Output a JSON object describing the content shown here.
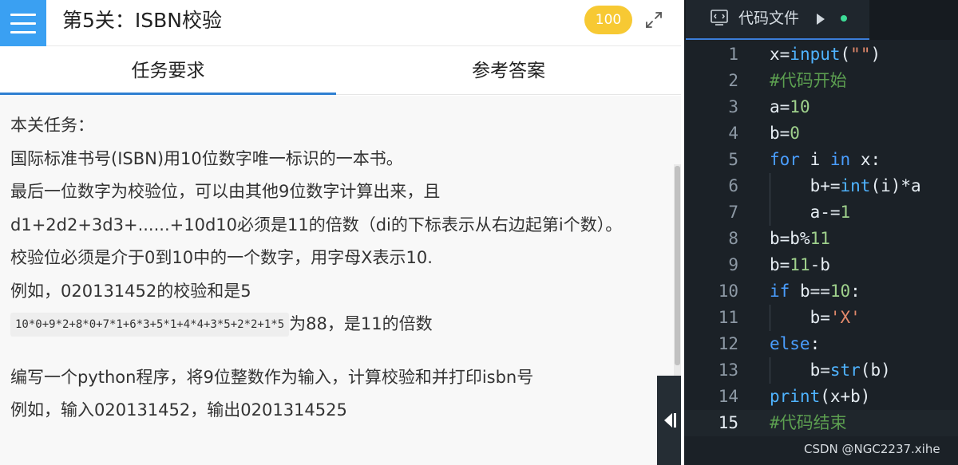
{
  "header": {
    "title": "第5关：ISBN校验",
    "score": "100"
  },
  "tabs": [
    {
      "label": "任务要求",
      "active": true
    },
    {
      "label": "参考答案",
      "active": false
    }
  ],
  "task": {
    "lines": [
      "本关任务：",
      "国际标准书号(ISBN)用10位数字唯一标识的一本书。",
      "最后一位数字为校验位，可以由其他9位数字计算出来，且",
      "d1+2d2+3d3+......+10d10必须是11的倍数（di的下标表示从右边起第i个数）。",
      "校验位必须是介于0到10中的一个数字，用字母X表示10.",
      "例如，020131452的校验和是5"
    ],
    "formula": "10*0+9*2+8*0+7*1+6*3+5*1+4*4+3*5+2*2+1*5",
    "formula_suffix": "为88，是11的倍数",
    "program_lines": [
      "编写一个python程序，将9位整数作为输入，计算校验和并打印isbn号",
      "例如，输入020131452，输出0201314525"
    ]
  },
  "editor": {
    "file_tab_label": "代码文件",
    "active_line": 15,
    "code": [
      "x=input(\"\")",
      "#代码开始",
      "a=10",
      "b=0",
      "for i in x:",
      "    b+=int(i)*a",
      "    a-=1",
      "b=b%11",
      "b=11-b",
      "if b==10:",
      "    b='X'",
      "else:",
      "    b=str(b)",
      "print(x+b)",
      "#代码结束"
    ]
  },
  "watermark": "CSDN @NGC2237.xihe",
  "colors": {
    "menu_button": "#3aa0f2",
    "score_badge": "#f7c933",
    "active_tab_underline": "#2f7fd1",
    "editor_background": "#1b2127",
    "keyword": "#4a9eff",
    "number": "#9fd18c",
    "string": "#e2896b",
    "comment": "#5c9f50"
  },
  "icons": [
    "menu-icon",
    "expand-icon",
    "collapse-panel-icon",
    "code-file-icon",
    "run-arrow-icon"
  ]
}
